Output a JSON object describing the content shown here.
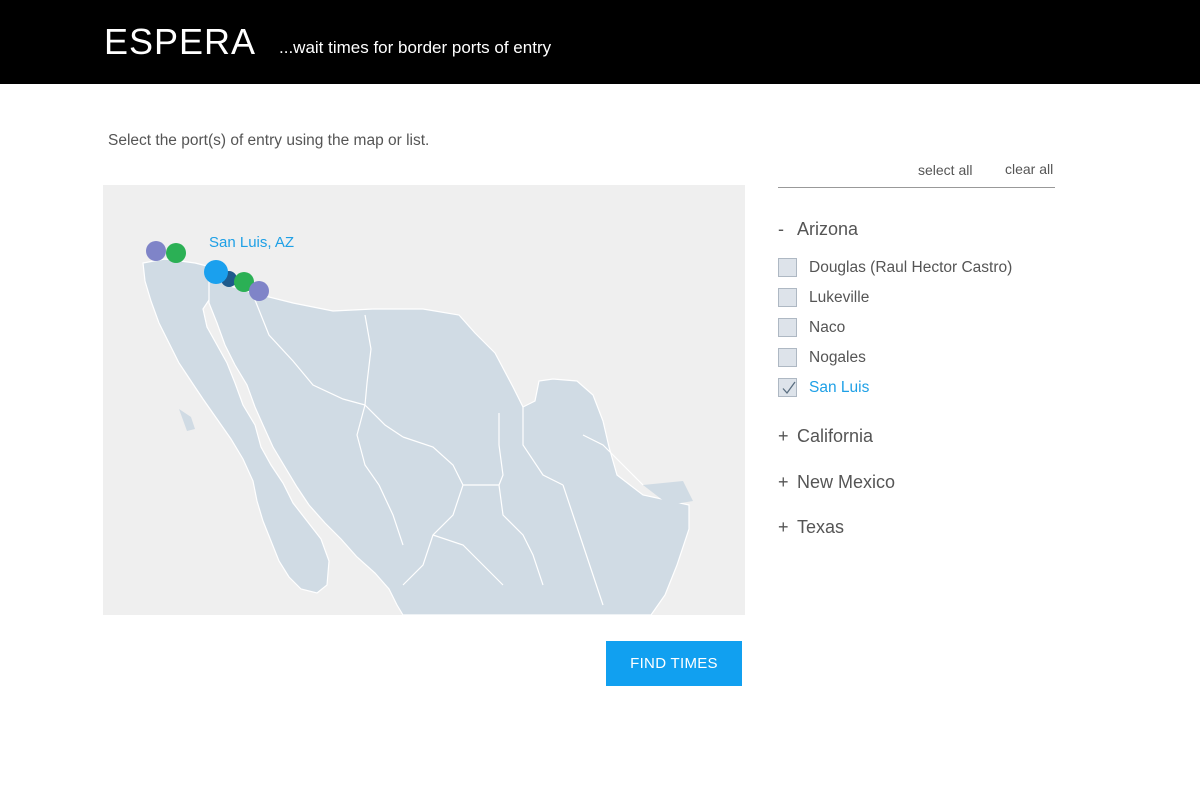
{
  "header": {
    "brand": "ESPERA",
    "tagline": "...wait times for border ports of entry"
  },
  "instructions": "Select the port(s) of entry using the map or list.",
  "map": {
    "highlight_label": "San Luis, AZ",
    "colors": {
      "land": "#d0dbe4",
      "background": "#efefef",
      "selected": "#1aa0ee",
      "purple": "#7f84c8",
      "green": "#2bb055",
      "dark_blue": "#1e5a8c"
    }
  },
  "list": {
    "select_all": "select all",
    "clear_all": "clear all",
    "states": [
      {
        "name": "Arizona",
        "sign": "-",
        "expanded": true,
        "ports": [
          {
            "label": "Douglas (Raul Hector Castro)",
            "checked": false
          },
          {
            "label": "Lukeville",
            "checked": false
          },
          {
            "label": "Naco",
            "checked": false
          },
          {
            "label": "Nogales",
            "checked": false
          },
          {
            "label": "San Luis",
            "checked": true
          }
        ]
      },
      {
        "name": "California",
        "sign": "+",
        "expanded": false
      },
      {
        "name": "New Mexico",
        "sign": "+",
        "expanded": false
      },
      {
        "name": "Texas",
        "sign": "+",
        "expanded": false
      }
    ]
  },
  "find_button": "FIND TIMES"
}
